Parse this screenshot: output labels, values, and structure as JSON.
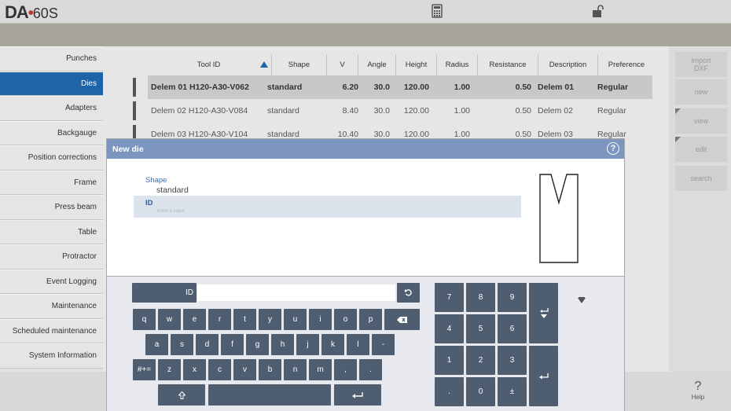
{
  "app": {
    "logo_main": "DA",
    "logo_dot": "•",
    "logo_model": "60S"
  },
  "sidebar": {
    "items": [
      {
        "label": "Punches",
        "active": false
      },
      {
        "label": "Dies",
        "active": true
      },
      {
        "label": "Adapters",
        "active": false
      },
      {
        "label": "Backgauge",
        "active": false
      },
      {
        "label": "Position corrections",
        "active": false
      },
      {
        "label": "Frame",
        "active": false
      },
      {
        "label": "Press beam",
        "active": false
      },
      {
        "label": "Table",
        "active": false
      },
      {
        "label": "Protractor",
        "active": false
      },
      {
        "label": "Event Logging",
        "active": false
      },
      {
        "label": "Maintenance",
        "active": false
      },
      {
        "label": "Scheduled maintenance",
        "active": false
      },
      {
        "label": "System Information",
        "active": false
      }
    ]
  },
  "table": {
    "headers": [
      "Tool ID",
      "Shape",
      "V",
      "Angle",
      "Height",
      "Radius",
      "Resistance",
      "Description",
      "Preference"
    ],
    "rows": [
      [
        "Delem 01 H120-A30-V062",
        "standard",
        "6.20",
        "30.0",
        "120.00",
        "1.00",
        "0.50",
        "Delem 01",
        "Regular"
      ],
      [
        "Delem 02 H120-A30-V084",
        "standard",
        "8.40",
        "30.0",
        "120.00",
        "1.00",
        "0.50",
        "Delem 02",
        "Regular"
      ],
      [
        "Delem 03 H120-A30-V104",
        "standard",
        "10.40",
        "30.0",
        "120.00",
        "1.00",
        "0.50",
        "Delem 03",
        "Regular"
      ]
    ]
  },
  "right_panel": {
    "import_dxf": "import\nDXF",
    "new": "new",
    "view": "view",
    "edit": "edit",
    "search": "search"
  },
  "dialog": {
    "title": "New die",
    "help": "?",
    "shape_label": "Shape",
    "shape_value": "standard",
    "id_label": "ID",
    "id_placeholder": "enter a value"
  },
  "keyboard": {
    "field_label": "ID",
    "row1": [
      "q",
      "w",
      "e",
      "r",
      "t",
      "y",
      "u",
      "i",
      "o",
      "p"
    ],
    "row2": [
      "a",
      "s",
      "d",
      "f",
      "g",
      "h",
      "j",
      "k",
      "l",
      "-"
    ],
    "row3": [
      "#+=",
      "z",
      "x",
      "c",
      "v",
      "b",
      "n",
      "m",
      ",",
      "."
    ],
    "numpad": [
      [
        "7",
        "8",
        "9"
      ],
      [
        "4",
        "5",
        "6"
      ],
      [
        "1",
        "2",
        "3"
      ],
      [
        ".",
        "0",
        "±"
      ]
    ]
  },
  "bottom": {
    "help_label": "Help",
    "help_icon": "?"
  },
  "colors": {
    "accent": "#1e64a8",
    "dialog_title": "#7c96bf",
    "key": "#4e5d6f"
  }
}
